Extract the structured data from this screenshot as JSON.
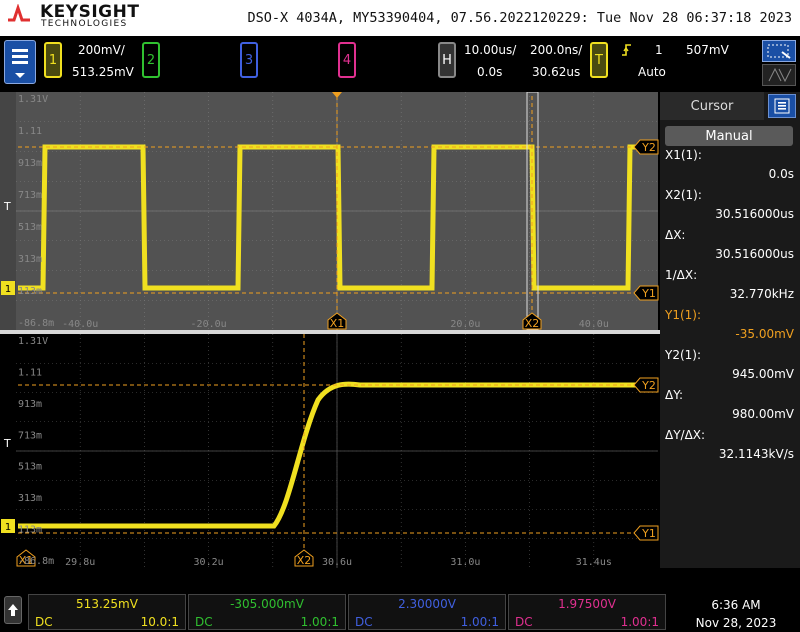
{
  "header": {
    "brand": "KEYSIGHT",
    "brand_sub": "TECHNOLOGIES",
    "title": "DSO-X 4034A, MY53390404, 07.56.2022120229: Tue Nov 28 06:37:18 2023"
  },
  "channels": [
    {
      "num": "1",
      "scale": "200mV/",
      "offset": "513.25mV",
      "color": "#f0e020"
    },
    {
      "num": "2",
      "color": "#30c030"
    },
    {
      "num": "3",
      "color": "#4060e0"
    },
    {
      "num": "4",
      "color": "#e03090"
    }
  ],
  "horizontal": {
    "label": "H",
    "main_scale": "10.00us/",
    "main_delay": "0.0s",
    "zoom_scale": "200.0ns/",
    "zoom_delay": "30.62us"
  },
  "trigger": {
    "label": "T",
    "source": "1",
    "level": "507mV",
    "mode": "Auto"
  },
  "main_window": {
    "y_labels": [
      "1.31V",
      "1.11",
      "913m",
      "713m",
      "513m",
      "313m",
      "113m",
      "-86.8m"
    ],
    "x_labels": [
      "-40.0u",
      "-20.0u",
      "20.0u",
      "40.0u"
    ],
    "markers": {
      "x1": "X1",
      "x2": "X2",
      "y1": "Y1",
      "y2": "Y2",
      "trig": "T",
      "gnd": "1"
    }
  },
  "zoom_window": {
    "y_labels": [
      "1.31V",
      "1.11",
      "913m",
      "713m",
      "513m",
      "313m",
      "113m",
      "-86.8m"
    ],
    "x_labels": [
      "29.8u",
      "30.2u",
      "30.6u",
      "31.0u",
      "31.4us"
    ],
    "markers": {
      "x1": "X1",
      "x2": "X2",
      "y1": "Y1",
      "y2": "Y2",
      "trig": "T",
      "gnd": "1"
    }
  },
  "cursor_panel": {
    "tab": "Cursor",
    "mode": "Manual",
    "rows": [
      {
        "label": "X1(1):",
        "value": "0.0s"
      },
      {
        "label": "X2(1):",
        "value": "30.516000us"
      },
      {
        "label": "ΔX:",
        "value": "30.516000us"
      },
      {
        "label": "1/ΔX:",
        "value": "32.770kHz"
      },
      {
        "label": "Y1(1):",
        "value": "-35.00mV"
      },
      {
        "label": "Y2(1):",
        "value": "945.00mV"
      },
      {
        "label": "ΔY:",
        "value": "980.00mV"
      },
      {
        "label": "ΔY/ΔX:",
        "value": "32.1143kV/s"
      }
    ]
  },
  "bottom": {
    "channels": [
      {
        "value": "513.25mV",
        "coupling": "DC",
        "probe": "10.0:1",
        "color": "#f0e020"
      },
      {
        "value": "-305.000mV",
        "coupling": "DC",
        "probe": "1.00:1",
        "color": "#30c030"
      },
      {
        "value": "2.30000V",
        "coupling": "DC",
        "probe": "1.00:1",
        "color": "#4060e0"
      },
      {
        "value": "1.97500V",
        "coupling": "DC",
        "probe": "1.00:1",
        "color": "#e03090"
      }
    ],
    "time": "6:36 AM",
    "date": "Nov 28, 2023"
  },
  "colors": {
    "trace": "#f0e020",
    "cursor": "#f0a020",
    "accent": "#1a4fa5"
  }
}
